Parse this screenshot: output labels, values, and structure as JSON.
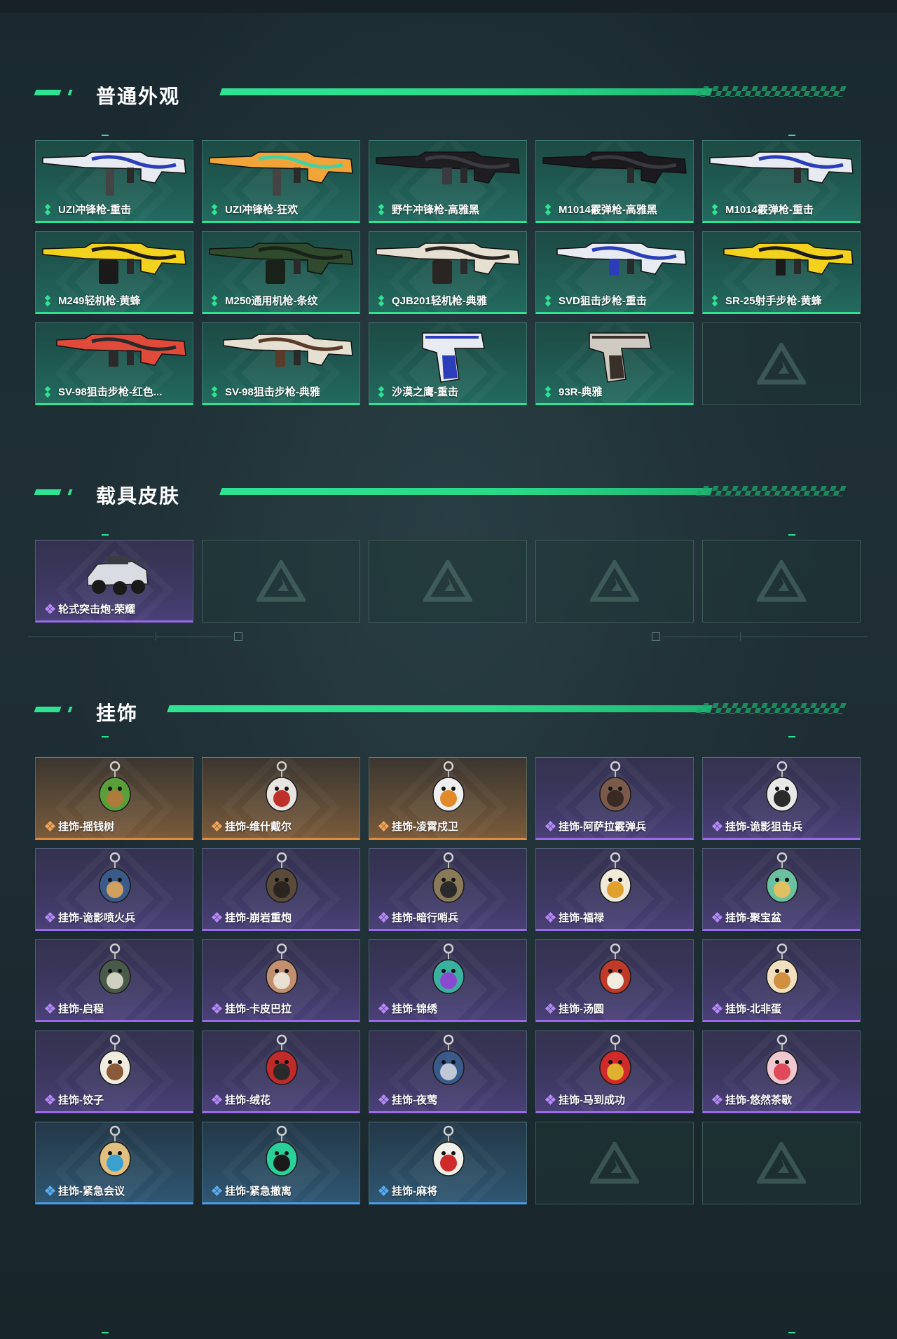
{
  "sections": [
    {
      "title": "普通外观",
      "items": [
        {
          "label": "UZI冲锋枪-重击",
          "rarity": "green",
          "icon": "uzi-smg-icon",
          "colors": [
            "#e8ecf2",
            "#2b3db8"
          ]
        },
        {
          "label": "UZI冲锋枪-狂欢",
          "rarity": "green",
          "icon": "uzi-smg-icon",
          "colors": [
            "#f0a43a",
            "#46d1a0"
          ]
        },
        {
          "label": "野牛冲锋枪-高雅黑",
          "rarity": "green",
          "icon": "bizon-smg-icon",
          "colors": [
            "#1e1e22",
            "#3a3a40"
          ]
        },
        {
          "label": "M1014霰弹枪-高雅黑",
          "rarity": "green",
          "icon": "shotgun-icon",
          "colors": [
            "#1a1a1e",
            "#38383e"
          ]
        },
        {
          "label": "M1014霰弹枪-重击",
          "rarity": "green",
          "icon": "shotgun-icon",
          "colors": [
            "#e8ecf2",
            "#2b3db8"
          ]
        },
        {
          "label": "M249轻机枪-黄蜂",
          "rarity": "green",
          "icon": "lmg-icon",
          "colors": [
            "#f2d21c",
            "#1a1a1a"
          ]
        },
        {
          "label": "M250通用机枪-条纹",
          "rarity": "green",
          "icon": "lmg-icon",
          "colors": [
            "#2f4a2c",
            "#182218"
          ]
        },
        {
          "label": "QJB201轻机枪-典雅",
          "rarity": "green",
          "icon": "lmg-icon",
          "colors": [
            "#e6e0d2",
            "#2a2522"
          ]
        },
        {
          "label": "SVD狙击步枪-重击",
          "rarity": "green",
          "icon": "sniper-rifle-icon",
          "colors": [
            "#e8ecf2",
            "#2b3db8"
          ]
        },
        {
          "label": "SR-25射手步枪-黄蜂",
          "rarity": "green",
          "icon": "marksman-rifle-icon",
          "colors": [
            "#f2d21c",
            "#1a1a1a"
          ]
        },
        {
          "label": "SV-98狙击步枪-红色...",
          "rarity": "green",
          "icon": "sniper-rifle-icon",
          "colors": [
            "#e04a3a",
            "#2a2a2a"
          ]
        },
        {
          "label": "SV-98狙击步枪-典雅",
          "rarity": "green",
          "icon": "sniper-rifle-icon",
          "colors": [
            "#e6e0d2",
            "#5a3a28"
          ]
        },
        {
          "label": "沙漠之鹰-重击",
          "rarity": "green",
          "icon": "pistol-icon",
          "colors": [
            "#e8ecf2",
            "#2b3db8"
          ]
        },
        {
          "label": "93R-典雅",
          "rarity": "green",
          "icon": "pistol-icon",
          "colors": [
            "#cfcac2",
            "#3a302a"
          ]
        },
        {
          "label": "",
          "rarity": "empty"
        }
      ]
    },
    {
      "title": "载具皮肤",
      "items": [
        {
          "label": "轮式突击炮-荣耀",
          "rarity": "purple",
          "icon": "armored-vehicle-icon",
          "colors": [
            "#d9dce2",
            "#3a3c44"
          ]
        },
        {
          "label": "",
          "rarity": "empty"
        },
        {
          "label": "",
          "rarity": "empty"
        },
        {
          "label": "",
          "rarity": "empty"
        },
        {
          "label": "",
          "rarity": "empty"
        }
      ]
    },
    {
      "title": "挂饰",
      "items": [
        {
          "label": "挂饰-摇钱树",
          "rarity": "orange",
          "icon": "money-tree-charm-icon",
          "colors": [
            "#5aa03a",
            "#b07a3a"
          ]
        },
        {
          "label": "挂饰-维什戴尔",
          "rarity": "orange",
          "icon": "card-charm-icon",
          "colors": [
            "#e8e4e0",
            "#c0302a"
          ]
        },
        {
          "label": "挂饰-凌霄戍卫",
          "rarity": "orange",
          "icon": "bird-charm-icon",
          "colors": [
            "#f0f0f0",
            "#e08a2a"
          ]
        },
        {
          "label": "挂饰-阿萨拉霰弹兵",
          "rarity": "purple",
          "icon": "soldier-charm-icon",
          "colors": [
            "#7a5a4a",
            "#3a2a24"
          ]
        },
        {
          "label": "挂饰-诡影狙击兵",
          "rarity": "purple",
          "icon": "soldier-charm-icon",
          "colors": [
            "#e8e8e8",
            "#2a2a2a"
          ]
        },
        {
          "label": "挂饰-诡影喷火兵",
          "rarity": "purple",
          "icon": "soldier-charm-icon",
          "colors": [
            "#3a5a8a",
            "#d0a060"
          ]
        },
        {
          "label": "挂饰-崩岩重炮",
          "rarity": "purple",
          "icon": "soldier-charm-icon",
          "colors": [
            "#5a4a3a",
            "#2a2420"
          ]
        },
        {
          "label": "挂饰-暗行哨兵",
          "rarity": "purple",
          "icon": "soldier-charm-icon",
          "colors": [
            "#8a7a5a",
            "#2a2a2a"
          ]
        },
        {
          "label": "挂饰-福禄",
          "rarity": "purple",
          "icon": "gourd-charm-icon",
          "colors": [
            "#f0ead8",
            "#e0a030"
          ]
        },
        {
          "label": "挂饰-聚宝盆",
          "rarity": "purple",
          "icon": "treasure-bowl-charm-icon",
          "colors": [
            "#6ac0a0",
            "#e0c060"
          ]
        },
        {
          "label": "挂饰-启程",
          "rarity": "purple",
          "icon": "medal-charm-icon",
          "colors": [
            "#4a5a4a",
            "#d0d0c0"
          ]
        },
        {
          "label": "挂饰-卡皮巴拉",
          "rarity": "purple",
          "icon": "capybara-charm-icon",
          "colors": [
            "#c09070",
            "#e8e0d0"
          ]
        },
        {
          "label": "挂饰-锦绣",
          "rarity": "purple",
          "icon": "butterfly-charm-icon",
          "colors": [
            "#3ab0a0",
            "#8a4ad0"
          ]
        },
        {
          "label": "挂饰-汤圆",
          "rarity": "purple",
          "icon": "rice-ball-charm-icon",
          "colors": [
            "#c03a2a",
            "#f0ece0"
          ]
        },
        {
          "label": "挂饰-北非蛋",
          "rarity": "purple",
          "icon": "shakshuka-charm-icon",
          "colors": [
            "#f0e0c0",
            "#d09040"
          ]
        },
        {
          "label": "挂饰-饺子",
          "rarity": "purple",
          "icon": "dumpling-charm-icon",
          "colors": [
            "#f0ece0",
            "#8a5a3a"
          ]
        },
        {
          "label": "挂饰-绒花",
          "rarity": "purple",
          "icon": "flower-charm-icon",
          "colors": [
            "#c02a2a",
            "#2a2a2a"
          ]
        },
        {
          "label": "挂饰-夜莺",
          "rarity": "purple",
          "icon": "feather-charm-icon",
          "colors": [
            "#3a5a8a",
            "#c0c8d8"
          ]
        },
        {
          "label": "挂饰-马到成功",
          "rarity": "purple",
          "icon": "horse-charm-icon",
          "colors": [
            "#d02a2a",
            "#e0b030"
          ]
        },
        {
          "label": "挂饰-悠然茶歇",
          "rarity": "purple",
          "icon": "cupcake-charm-icon",
          "colors": [
            "#f0c8d0",
            "#e04a5a"
          ]
        },
        {
          "label": "挂饰-紧急会议",
          "rarity": "blue",
          "icon": "bear-charm-icon",
          "colors": [
            "#e0c080",
            "#3aa0d0"
          ]
        },
        {
          "label": "挂饰-紧急撤离",
          "rarity": "blue",
          "icon": "plaque-charm-icon",
          "colors": [
            "#2ad09a",
            "#1a1a1a"
          ]
        },
        {
          "label": "挂饰-麻将",
          "rarity": "blue",
          "icon": "mahjong-tile-charm-icon",
          "colors": [
            "#f0f0ea",
            "#d02a2a"
          ]
        },
        {
          "label": "",
          "rarity": "empty"
        },
        {
          "label": "",
          "rarity": "empty"
        }
      ]
    }
  ],
  "accent": "#2fe393",
  "rarity_colors": {
    "green": "#2fe393",
    "purple": "#9a6ae8",
    "orange": "#e08a3c",
    "blue": "#4a9be8"
  }
}
